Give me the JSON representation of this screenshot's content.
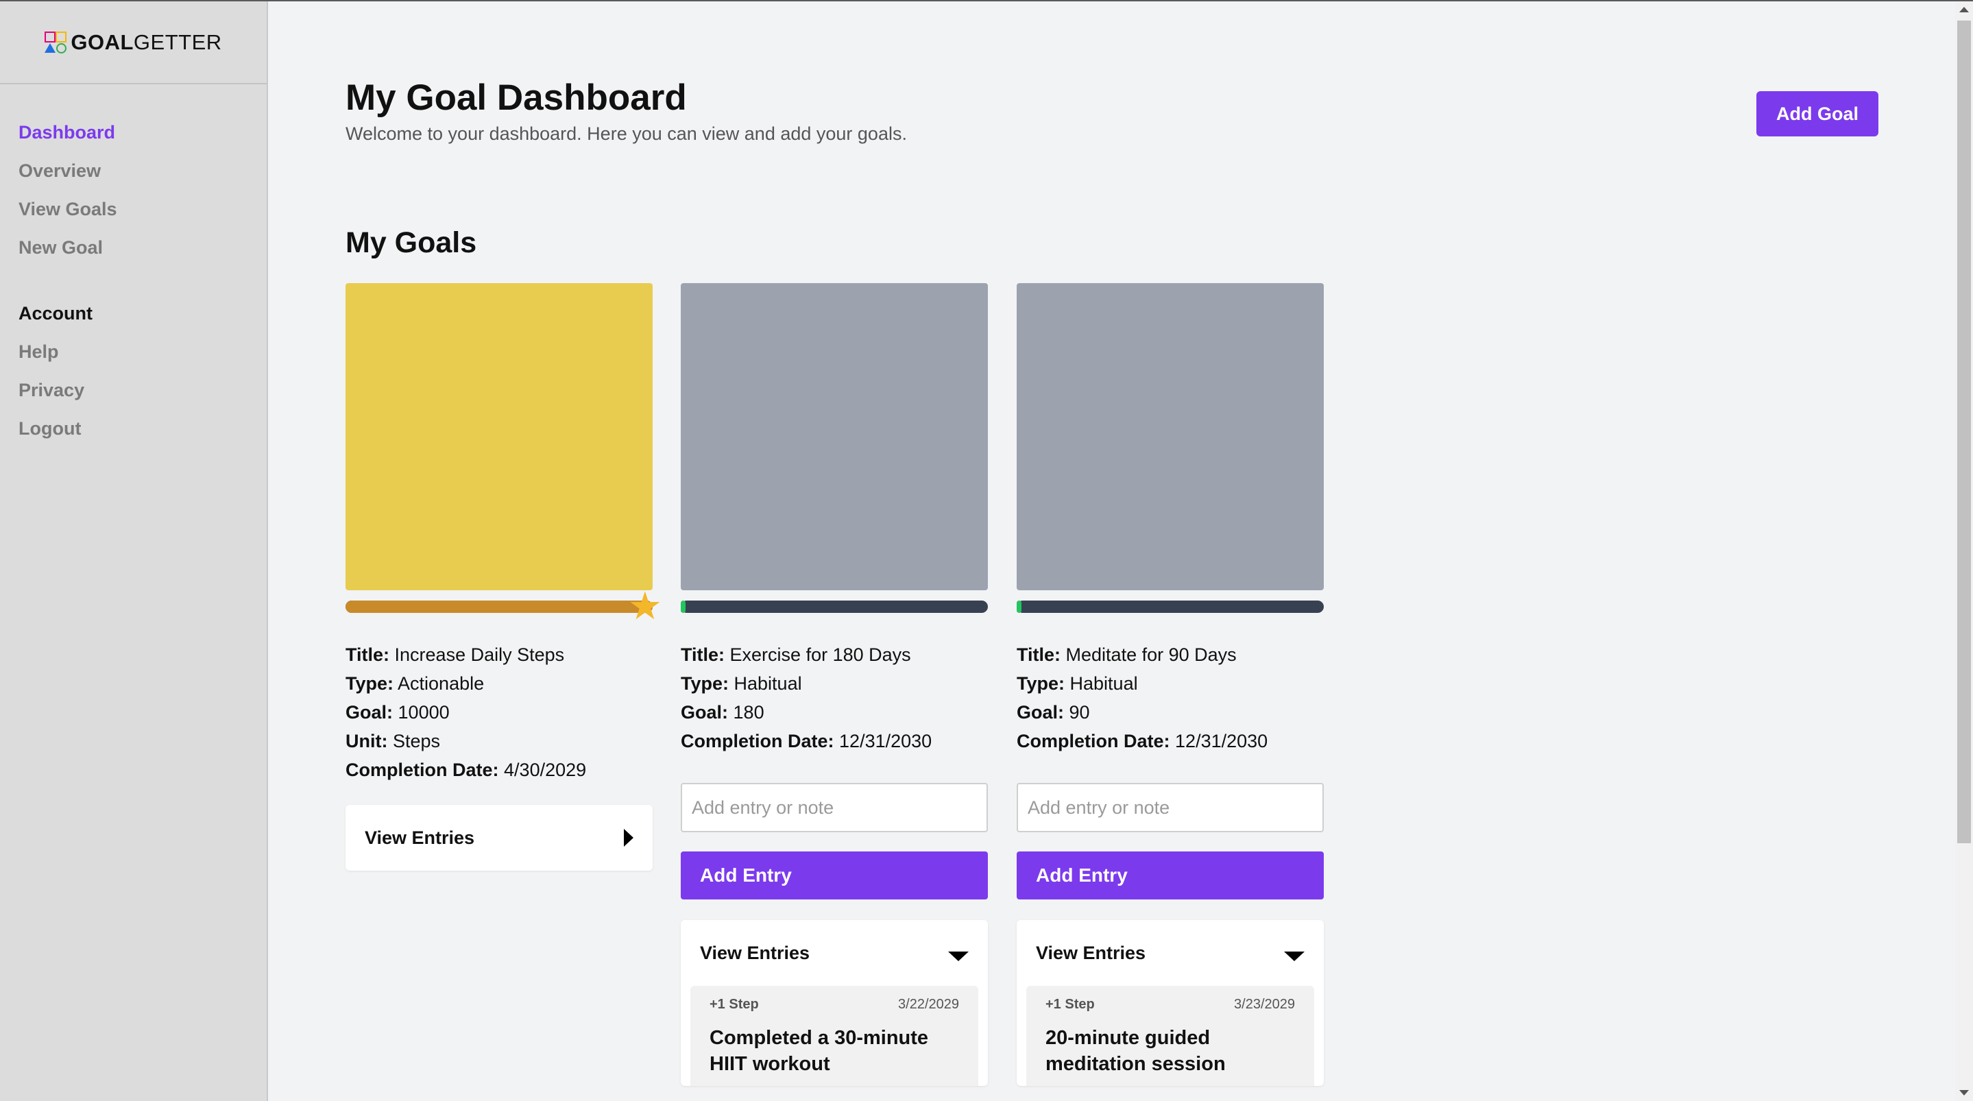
{
  "app": {
    "logo_bold": "GOAL",
    "logo_light": "GETTER"
  },
  "sidebar": {
    "primary": [
      {
        "label": "Dashboard",
        "active": true
      },
      {
        "label": "Overview"
      },
      {
        "label": "View Goals"
      },
      {
        "label": "New Goal"
      }
    ],
    "secondary": [
      {
        "label": "Account"
      },
      {
        "label": "Help"
      },
      {
        "label": "Privacy"
      },
      {
        "label": "Logout"
      }
    ]
  },
  "header": {
    "title": "My Goal Dashboard",
    "subtitle": "Welcome to your dashboard. Here you can view and add your goals.",
    "add_goal_label": "Add Goal"
  },
  "goals_section": {
    "title": "My Goals"
  },
  "labels": {
    "title": "Title:",
    "type": "Type:",
    "goal": "Goal:",
    "unit": "Unit:",
    "completion_date": "Completion Date:",
    "add_entry_placeholder": "Add entry or note",
    "add_entry_button": "Add Entry",
    "view_entries": "View Entries"
  },
  "goals": [
    {
      "image_color": "#e8cc50",
      "progress": 1.0,
      "progress_color": "#c98a2a",
      "completed": true,
      "title": "Increase Daily Steps",
      "type": "Actionable",
      "goal": "10000",
      "unit": "Steps",
      "completion_date": "4/30/2029"
    },
    {
      "image_color": "#9ca3af",
      "progress": 0.01,
      "progress_color": "#22c55e",
      "completed": false,
      "title": "Exercise for 180 Days",
      "type": "Habitual",
      "goal": "180",
      "completion_date": "12/31/2030",
      "entry": {
        "increment": "+1 Step",
        "date": "3/22/2029",
        "text": "Completed a 30-minute HIIT workout"
      }
    },
    {
      "image_color": "#9ca3af",
      "progress": 0.011,
      "progress_color": "#22c55e",
      "completed": false,
      "title": "Meditate for 90 Days",
      "type": "Habitual",
      "goal": "90",
      "completion_date": "12/31/2030",
      "entry": {
        "increment": "+1 Step",
        "date": "3/23/2029",
        "text": "20-minute guided meditation session"
      }
    }
  ]
}
